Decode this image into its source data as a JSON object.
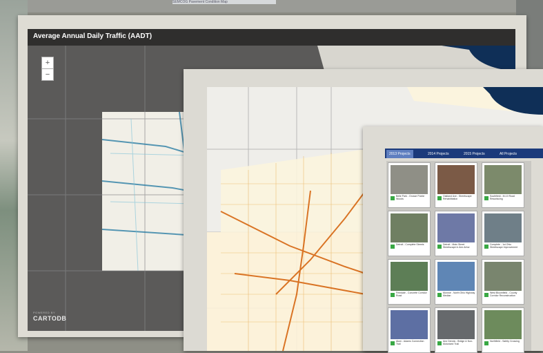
{
  "background": {
    "caption": "SEMCOG Pavement Condition Map"
  },
  "map1": {
    "title": "Average Annual Daily Traffic (AADT)",
    "zoom_in": "+",
    "zoom_out": "−",
    "attribution_small": "POWERED BY",
    "attribution_logo": "CARTODB",
    "accent_color": "#1f7fa8"
  },
  "map2": {
    "accent_color": "#e07b00"
  },
  "projects": {
    "tabs": [
      "2013 Projects",
      "2014 Projects",
      "2015 Projects",
      "All Projects"
    ],
    "active_tab": "2013 Projects",
    "cards": [
      {
        "caption": "Belle Park - Grosse Pointe Woods",
        "thumb": "#8f8f86"
      },
      {
        "caption": "Oakland Ave - Streetscape Rehabilitation",
        "thumb": "#7b5a46"
      },
      {
        "caption": "Southfield - M-10 Road Resurfacing",
        "thumb": "#7c8a6b"
      },
      {
        "caption": "Detroit - Complete Streets",
        "thumb": "#6f7f62"
      },
      {
        "caption": "Detroit - Main Street Streetscape in Ann Arbor",
        "thumb": "#6e79a6"
      },
      {
        "caption": "Complete - 1st Ohio Streetscape Improvement",
        "thumb": "#6f7f88"
      },
      {
        "caption": "Ferndale - Concrete Corridor Road",
        "thumb": "#5d7e56"
      },
      {
        "caption": "Monroe - North Ohio Highway Median",
        "thumb": "#5f86b5"
      },
      {
        "caption": "West Bloomfield - County Corridor Reconstruction",
        "thumb": "#79856e"
      },
      {
        "caption": "Alum - Adams Connection Trail",
        "thumb": "#5d6fa3"
      },
      {
        "caption": "Ann Dennis - Bridge & Non-Motorized Trail",
        "thumb": "#66696c"
      },
      {
        "caption": "Northfield - Safety Crossing",
        "thumb": "#6d8b5c"
      }
    ]
  }
}
